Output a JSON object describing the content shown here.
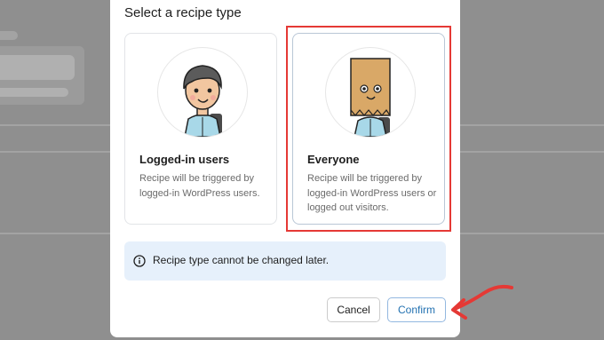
{
  "modal": {
    "title": "Select a recipe type",
    "options": [
      {
        "name": "Logged-in users",
        "description": "Recipe will be triggered by logged-in WordPress users.",
        "illustration": "person-avatar",
        "selected": false
      },
      {
        "name": "Everyone",
        "description": "Recipe will be triggered by logged-in WordPress users or logged out visitors.",
        "illustration": "paper-bag-head-avatar",
        "selected": true
      }
    ],
    "notice": {
      "icon": "info-icon",
      "text": "Recipe type cannot be changed later."
    },
    "buttons": {
      "cancel": "Cancel",
      "confirm": "Confirm"
    }
  },
  "annotations": {
    "highlight_color": "#e53935",
    "arrow_color": "#e53935"
  },
  "colors": {
    "overlay": "#8f8f8f",
    "accent": "#2271b1",
    "notice_bg": "#e6f0fb"
  }
}
